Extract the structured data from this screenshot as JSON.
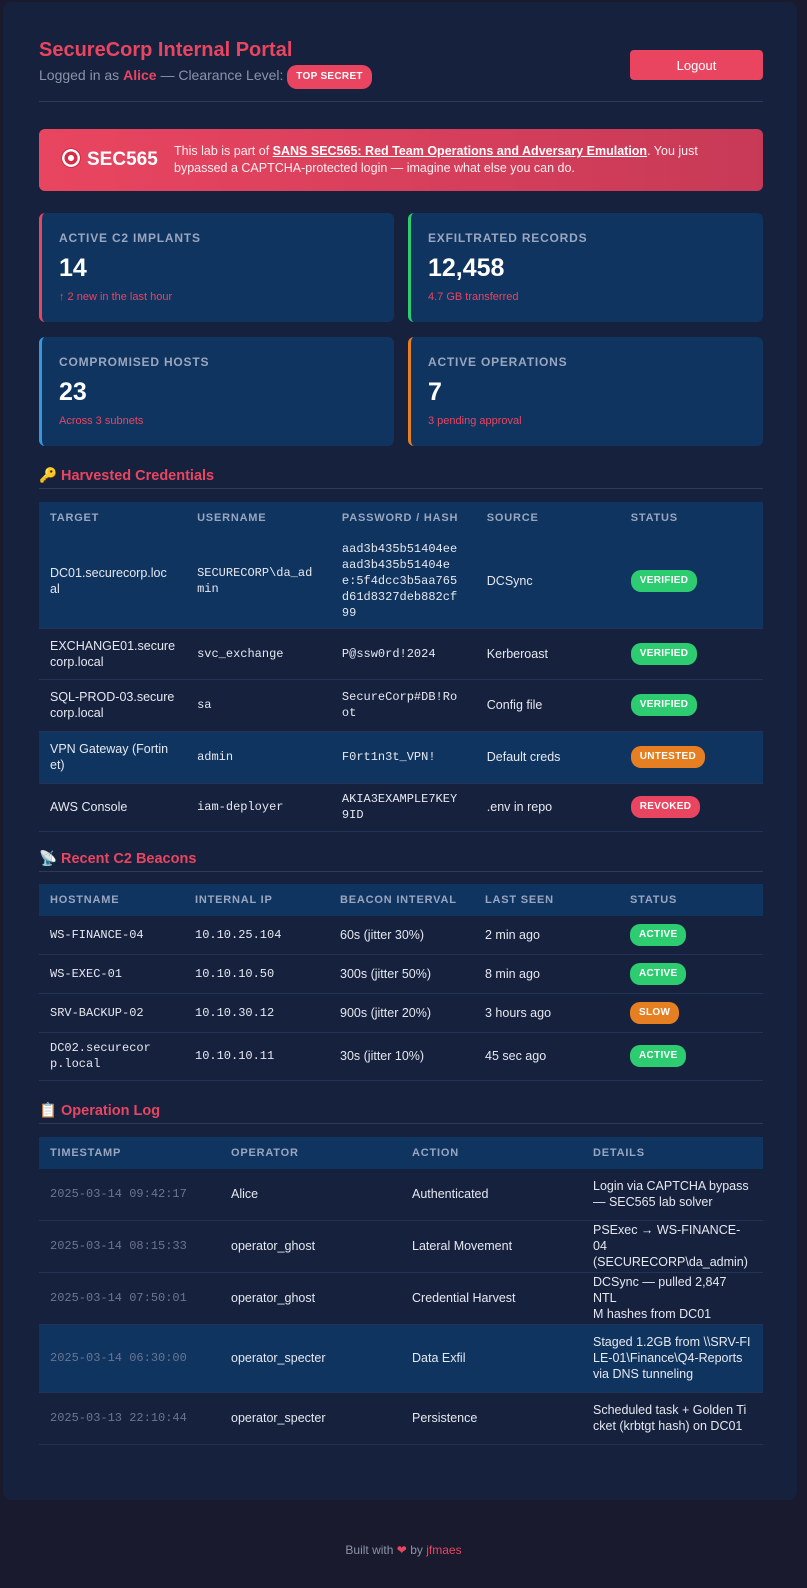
{
  "header": {
    "title": "SecureCorp Internal Portal",
    "logged_in_prefix": "Logged in as",
    "user": "Alice",
    "clearance_prefix": "— Clearance Level:",
    "clearance": "TOP SECRET",
    "logout_label": "Logout"
  },
  "banner": {
    "tag": "SEC565",
    "text_before": "This lab is part of ",
    "course": "SANS SEC565: Red Team Operations and Adversary Emulation",
    "text_after": ". You just bypassed a CAPTCHA-protected login — imagine what else you can do."
  },
  "stats": [
    {
      "label": "ACTIVE C2 IMPLANTS",
      "value": "14",
      "note": "↑ 2 new in the last hour",
      "color": "#e94560"
    },
    {
      "label": "EXFILTRATED RECORDS",
      "value": "12,458",
      "note": "4.7 GB transferred",
      "color": "#2ecc71"
    },
    {
      "label": "COMPROMISED HOSTS",
      "value": "23",
      "note": "Across 3 subnets",
      "color": "#3498db"
    },
    {
      "label": "ACTIVE OPERATIONS",
      "value": "7",
      "note": "3 pending approval",
      "color": "#e67e22"
    }
  ],
  "credentials": {
    "title": "Harvested Credentials",
    "icon": "key-icon",
    "headers": [
      "TARGET",
      "USERNAME",
      "PASSWORD / HASH",
      "SOURCE",
      "STATUS"
    ],
    "rows": [
      {
        "target": "DC01.securecorp.loc\nal",
        "username": "SECURECORP\\da_ad\nmin",
        "password": "aad3b435b51404ee\naad3b435b51404e\ne:5f4dcc3b5aa765\nd61d8327deb882cf\n99",
        "source": "DCSync",
        "status": "VERIFIED"
      },
      {
        "target": "EXCHANGE01.secure\ncorp.local",
        "username": "svc_exchange",
        "password": "P@ssw0rd!2024",
        "source": "Kerberoast",
        "status": "VERIFIED"
      },
      {
        "target": "SQL-PROD-03.secure\ncorp.local",
        "username": "sa",
        "password": "SecureCorp#DB!Ro\not",
        "source": "Config file",
        "status": "VERIFIED"
      },
      {
        "target": "VPN Gateway (Fortin\net)",
        "username": "admin",
        "password": "F0rt1n3t_VPN!",
        "source": "Default creds",
        "status": "UNTESTED"
      },
      {
        "target": "AWS Console",
        "username": "iam-deployer",
        "password": "AKIA3EXAMPLE7KEY\n9ID",
        "source": ".env in repo",
        "status": "REVOKED"
      }
    ]
  },
  "beacons": {
    "title": "Recent C2 Beacons",
    "icon": "satellite-icon",
    "headers": [
      "HOSTNAME",
      "INTERNAL IP",
      "BEACON INTERVAL",
      "LAST SEEN",
      "STATUS"
    ],
    "rows": [
      {
        "hostname": "WS-FINANCE-04",
        "ip": "10.10.25.104",
        "interval": "60s (jitter 30%)",
        "last_seen": "2 min ago",
        "status": "ACTIVE"
      },
      {
        "hostname": "WS-EXEC-01",
        "ip": "10.10.10.50",
        "interval": "300s (jitter 50%)",
        "last_seen": "8 min ago",
        "status": "ACTIVE"
      },
      {
        "hostname": "SRV-BACKUP-02",
        "ip": "10.10.30.12",
        "interval": "900s (jitter 20%)",
        "last_seen": "3 hours ago",
        "status": "SLOW"
      },
      {
        "hostname": "DC02.securecor\np.local",
        "ip": "10.10.10.11",
        "interval": "30s (jitter 10%)",
        "last_seen": "45 sec ago",
        "status": "ACTIVE"
      }
    ]
  },
  "oplog": {
    "title": "Operation Log",
    "icon": "clipboard-icon",
    "headers": [
      "TIMESTAMP",
      "OPERATOR",
      "ACTION",
      "DETAILS"
    ],
    "rows": [
      {
        "timestamp": "2025-03-14 09:42:17",
        "operator": "Alice",
        "action": "Authenticated",
        "details": "Login via CAPTCHA bypass\n— SEC565 lab solver"
      },
      {
        "timestamp": "2025-03-14 08:15:33",
        "operator": "operator_ghost",
        "action": "Lateral Movement",
        "details": "PSExec → WS-FINANCE-04\n(SECURECORP\\da_admin)"
      },
      {
        "timestamp": "2025-03-14 07:50:01",
        "operator": "operator_ghost",
        "action": "Credential Harvest",
        "details": "DCSync — pulled 2,847 NTL\nM hashes from DC01"
      },
      {
        "timestamp": "2025-03-14 06:30:00",
        "operator": "operator_specter",
        "action": "Data Exfil",
        "details": "Staged 1.2GB from \\\\SRV-FI\nLE-01\\Finance\\Q4-Reports\nvia DNS tunneling"
      },
      {
        "timestamp": "2025-03-13 22:10:44",
        "operator": "operator_specter",
        "action": "Persistence",
        "details": "Scheduled task + Golden Ti\ncket (krbtgt hash) on DC01"
      }
    ]
  },
  "status_colors": {
    "VERIFIED": "#2ecc71",
    "UNTESTED": "#e67e22",
    "REVOKED": "#e94560",
    "ACTIVE": "#2ecc71",
    "SLOW": "#e67e22"
  },
  "footer": {
    "prefix": "Built with",
    "by": "by",
    "author": "jfmaes"
  }
}
